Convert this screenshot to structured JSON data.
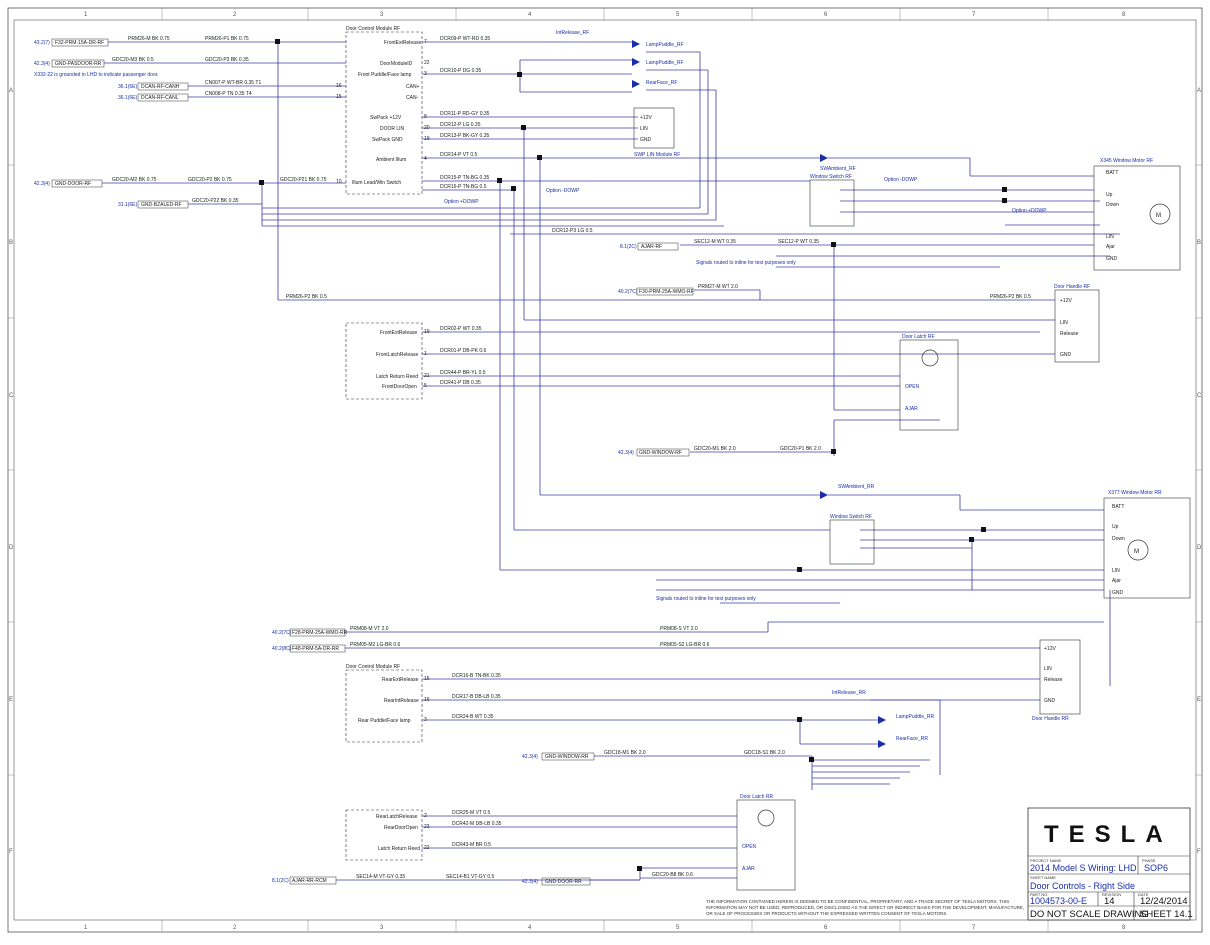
{
  "grid": {
    "cols": [
      "1",
      "2",
      "3",
      "4",
      "5",
      "6",
      "7",
      "8"
    ],
    "rows": [
      "A",
      "B",
      "C",
      "D",
      "E",
      "F"
    ]
  },
  "connectors_left": {
    "c1": "43.2(7)",
    "c1_tag": "F32-PRM-15A-DR-RF",
    "c2": "42.3(4)",
    "c2_tag": "GND-PASDOOR-RR",
    "note": "X332-22 is grounded in LHD to indicate passenger door.",
    "c3": "36.1(6E)",
    "c3_tag": "DCAN-RF-CANH",
    "c4": "36.1(6E)",
    "c4_tag": "DCAN-RF-CANL",
    "c5": "42.3(4)",
    "c5_tag": "GND-DOOR-RF",
    "c6": "31.1(6E)",
    "c6_tag": "GND-BZALED-RF",
    "c7": "40.2(7C)",
    "c7_tag": "F28-PRM-25A-WMO-RR",
    "c8": "40.2(8C)",
    "c8_tag": "F48-PRM-5A-DR-RR",
    "c9": "8.1(2C)",
    "c9_tag": "AJAR-RR-RCM",
    "c10": "8.1(2C)",
    "c10_tag": "AJAR-RF",
    "c11": "40.2(7C)",
    "c11_tag": "F30-PRM-25A-WMO-RF",
    "c12": "42.3(4)",
    "c12_tag": "GND-WINDOW-RF",
    "c13": "42.3(4)",
    "c13_tag": "GND-WINDOW-RR",
    "c14": "42.3(4)",
    "c14_tag": "GND-DOOR-RR"
  },
  "modules": {
    "dcm_rf": "Door Control Module RF",
    "dcm_rr": "Door Control Module RF",
    "window_switch_rf": "Window Switch RF",
    "window_switch_rr": "Window Switch RF",
    "window_motor_rf": "X345 Window Motor RF",
    "window_motor_rr": "X377 Window Motor RR",
    "door_handle_rf": "Door Handle RF",
    "door_handle_rr": "Door Handle RR",
    "door_latch_rf": "Door Latch RF",
    "door_latch_rr": "Door Latch RR",
    "sw_pack": "SWP LIN Module RF"
  },
  "dcm_rf_pins": [
    {
      "label": "FrontExtRelease",
      "pin": "7"
    },
    {
      "label": "DoorModuleID",
      "pin": "22"
    },
    {
      "label": "Front Puddle/Face lamp",
      "pin": "3"
    },
    {
      "label": "CAN+",
      "pin": "16"
    },
    {
      "label": "CAN-",
      "pin": "15"
    },
    {
      "label": "SwPack +12V",
      "pin": "8"
    },
    {
      "label": "DOOR LIN",
      "pin": "20"
    },
    {
      "label": "SwPack GND",
      "pin": "19"
    },
    {
      "label": "Ambient Illum",
      "pin": "4"
    },
    {
      "label": "Illum Lead/Win Switch",
      "pin": "10"
    }
  ],
  "dcm_rf_pins_lower": [
    {
      "label": "FrontExtRelease",
      "pin": "19"
    },
    {
      "label": "FrontLatchRelease",
      "pin": "1"
    },
    {
      "label": "Latch Return Reed",
      "pin": "21"
    },
    {
      "label": "FrontDoorOpen",
      "pin": "5"
    }
  ],
  "dcm_rr_pins": [
    {
      "label": "RearExtRelease",
      "pin": "15"
    },
    {
      "label": "RearIntRelease",
      "pin": "16"
    },
    {
      "label": "Rear Puddle/Face lamp",
      "pin": "3"
    }
  ],
  "dcm_rr_pins_lower": [
    {
      "label": "RearLatchRelease",
      "pin": "2"
    },
    {
      "label": "RearDoorOpen",
      "pin": "23"
    },
    {
      "label": "Latch Return Reed",
      "pin": "22"
    }
  ],
  "lamps": {
    "l1": "LampPuddle_RF",
    "l2": "LampPuddle_RF",
    "l3": "RearFace_RF",
    "l4": "IntRelease_RF",
    "l5": "SWAmbient_RF",
    "l6": "SWAmbient_RR",
    "l7": "IntRelease_RR",
    "l8": "LampPuddle_RR",
    "l9": "RearFace_RR"
  },
  "wires": {
    "w1": "PRM26-M BK 0.75",
    "w2": "PRM26-P1 BK 0.75",
    "w3": "GDC20-M3 BK 0.5",
    "w4": "GDC20-P3 BK 0.35",
    "w5": "CN007-P WT-BR 0.35 T1",
    "w6": "CN008-P TN 0.35 T4",
    "w7": "GDC20-M2 BK 0.75",
    "w8": "GDC20-P2 BK 0.75",
    "w9": "GDC20-P21 BK 0.75",
    "w10": "GDC20-P22 BK 0.35",
    "w11": "DCR09-P WT-RD 0.35",
    "w12": "DCR10-P DG 0.35",
    "w13": "DCR11-P RD-GY 0.35",
    "w14": "DCR12-P LG 0.35",
    "w15": "DCR13-P BK-GY 0.35",
    "w16": "DCR14-P VT 0.5",
    "w17": "DCR15-P TN-BG 0.35",
    "w18": "DCR16-P TN-BG 0.5",
    "w19": "PRM26-P2 BK 0.5",
    "w20": "DCR12-P3 LG 0.5",
    "w21": "PRM27-M WT 2.0",
    "w22": "PRM26-P2 BK 0.5",
    "w23": "DCR02-P WT 0.35",
    "w24": "DCR01-P DB-PK 0.6",
    "w25": "DCR44-P BR-YL 0.5",
    "w26": "DCR41-P DB 0.35",
    "w27": "SEC12-M WT 0.35",
    "w28": "SEC12-P WT 0.35",
    "w29": "GDC20-M1 BK 2.0",
    "w30": "GDC20-P1 BK 2.0",
    "w31": "PRM08-M VT 2.0",
    "w32": "PRM08-S VT 2.0",
    "w33": "PRM05-M2 LG-BR 0.6",
    "w34": "PRM05-S2 LG-BR 0.6",
    "w35": "DCR16-B TN-BK 0.35",
    "w36": "DCR17-B DB-LB 0.35",
    "w37": "DCR24-B WT 0.35",
    "w38": "GDC18-M1 BK 2.0",
    "w39": "GDC18-S1 BK 2.0",
    "w40": "DCR25-M VT 0.5",
    "w41": "DCR42-M DB-LB 0.35",
    "w42": "DCR43-M BR 0.5",
    "w43": "SEC14-M VT-GY 0.35",
    "w44": "SEC14-B1 VT-GY 0.5",
    "w45": "GDC20-B8 BK 0.6"
  },
  "notes": {
    "n1": "Signals routed to inline for test purposes only",
    "n2": "Signals routed to inline for test purposes only",
    "opt1": "Option +DOWP",
    "opt2": "Option -DOWP",
    "opt3": "Option +DOWP",
    "opt4": "Option -DOWP"
  },
  "motor_pins": [
    "BATT",
    "Up",
    "Down",
    "LIN",
    "Ajar",
    "GND"
  ],
  "handle_pins": [
    "+12V",
    "LIN",
    "Release",
    "GND"
  ],
  "latch_labels": [
    "OPEN",
    "AJAR"
  ],
  "title_block": {
    "logo": "TESLA",
    "project_label": "PROJECT NAME",
    "project": "2014 Model S Wiring: LHD",
    "phase_label": "PHASE",
    "phase": "SOP6",
    "sheet_label": "SHEET NAME",
    "sheet_name": "Door Controls - Right Side",
    "part_label": "PART NO.",
    "part": "1004573-00-E",
    "rev_label": "REVISION",
    "rev": "14",
    "date_label": "DATE",
    "date": "12/24/2014",
    "no_scale": "DO NOT SCALE DRAWING",
    "sheet_no": "SHEET 14.1",
    "disclaimer1": "THE INFORMATION CONTAINED HEREIN IS DEEMED TO BE CONFIDENTIAL, PROPRIETARY, AND A TRADE SECRET OF TESLA MOTORS. THIS",
    "disclaimer2": "INFORMATION MAY NOT BE USED, REPRODUCED, OR DISCLOSED AS THE DIRECT OR INDIRECT BASIS FOR THE DEVELOPMENT, MANUFACTURE,",
    "disclaimer3": "OR SALE OF PROCESSES OR PRODUCTS WITHOUT THE EXPRESSED WRITTEN CONSENT OF TESLA MOTORS."
  }
}
